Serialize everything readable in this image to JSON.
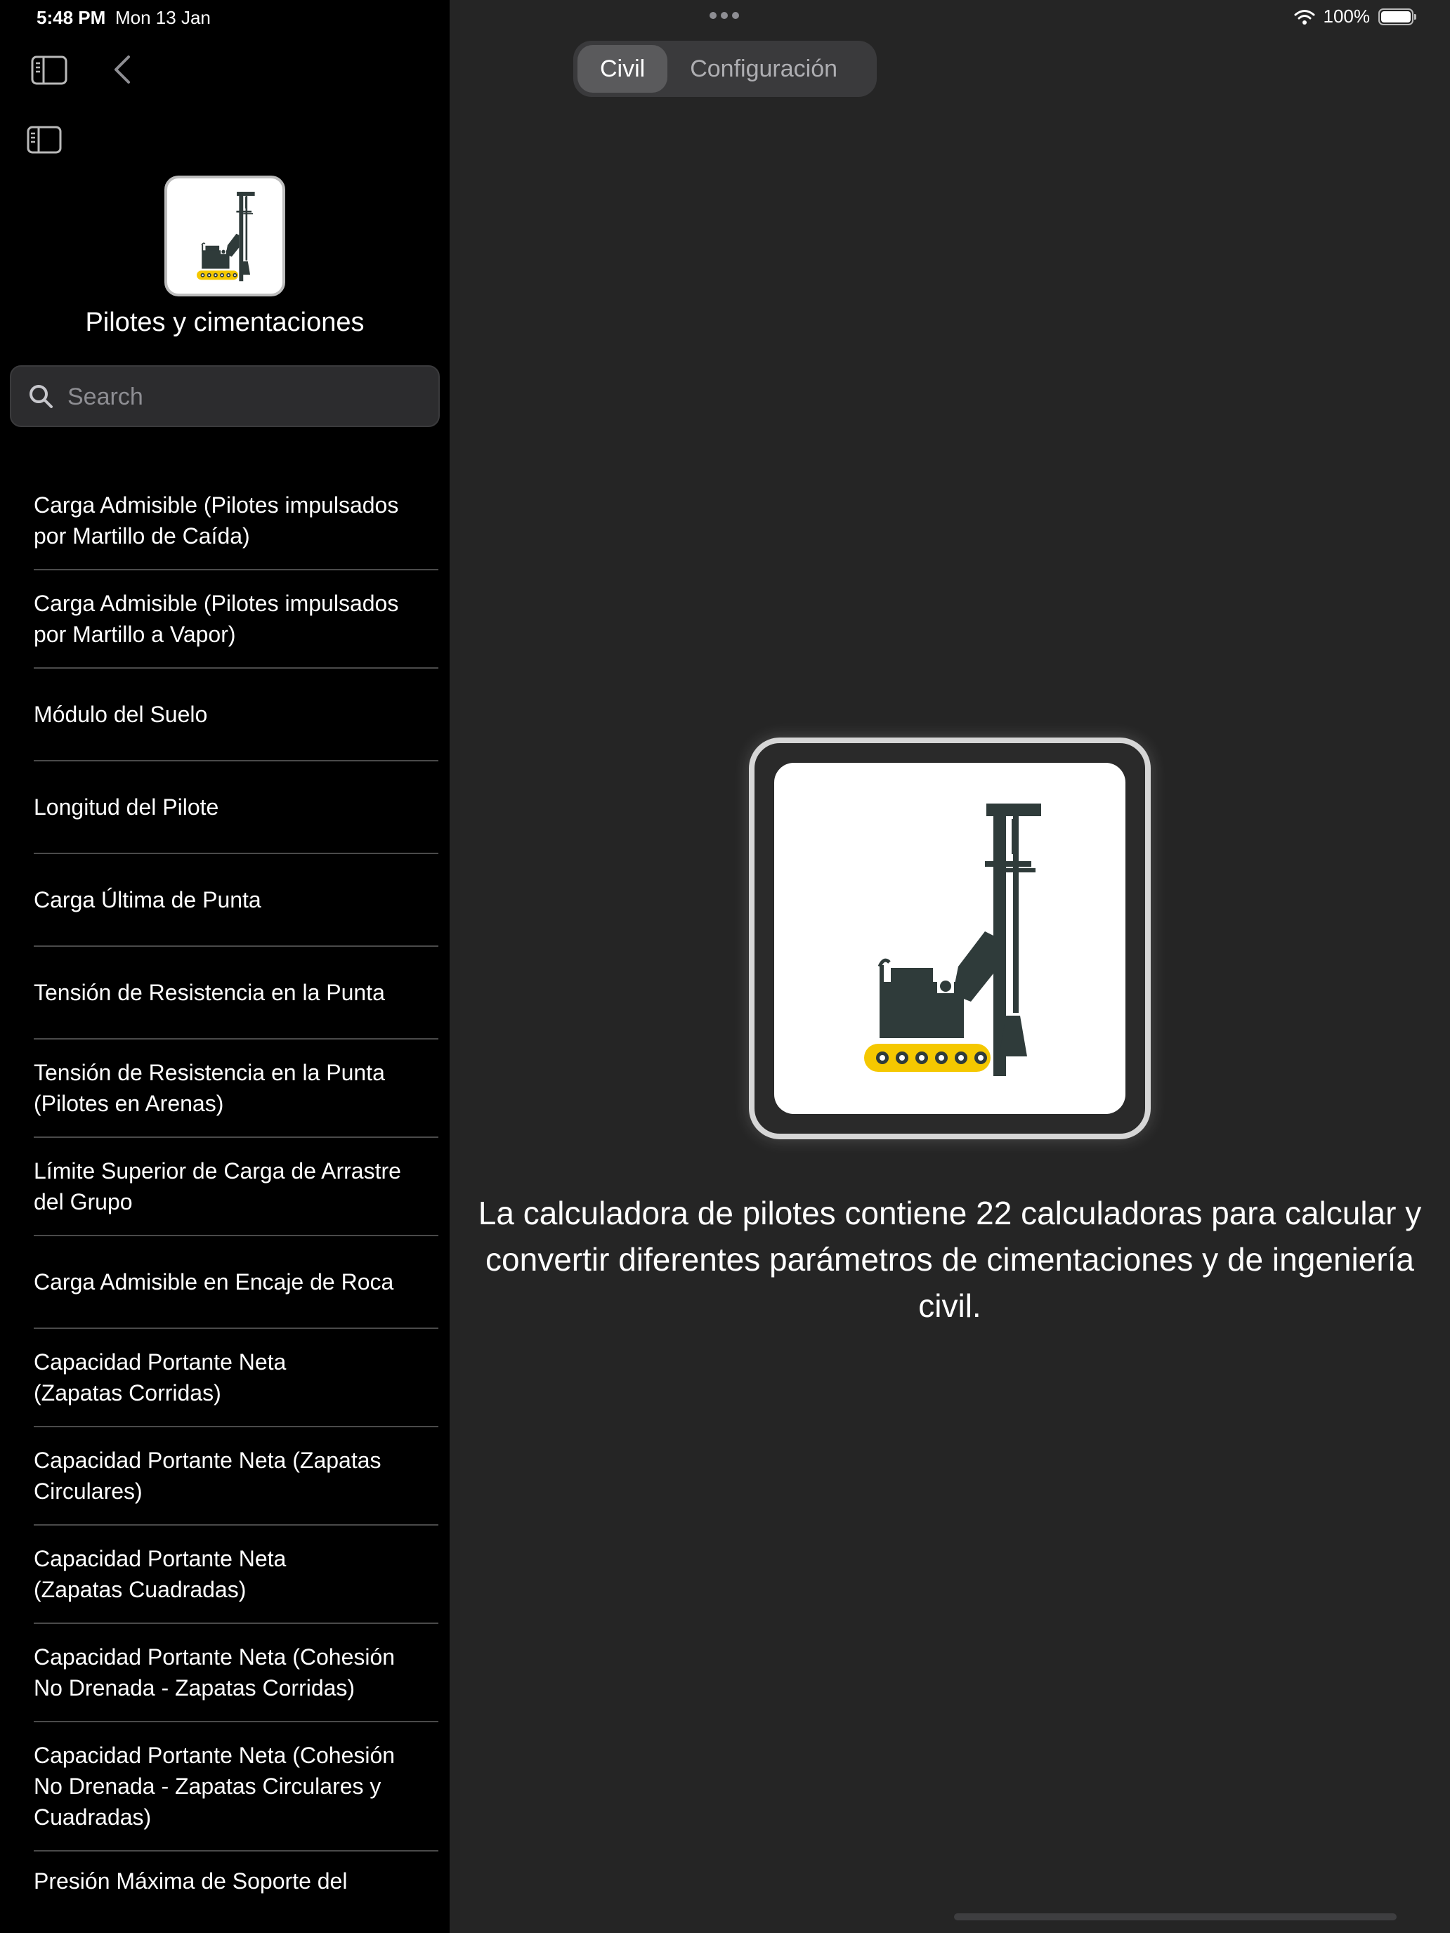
{
  "status_bar": {
    "time": "5:48 PM",
    "date": "Mon 13 Jan",
    "battery": "100%"
  },
  "sidebar": {
    "title": "Pilotes y cimentaciones",
    "search": {
      "placeholder": "Search",
      "value": ""
    },
    "items": [
      {
        "label": "Carga Admisible (Pilotes impulsados por Martillo de Caída)"
      },
      {
        "label": "Carga Admisible (Pilotes impulsados por Martillo a Vapor)"
      },
      {
        "label": "Módulo del Suelo"
      },
      {
        "label": "Longitud del Pilote"
      },
      {
        "label": "Carga Última de Punta"
      },
      {
        "label": "Tensión de Resistencia en la Punta"
      },
      {
        "label": "Tensión de Resistencia en la Punta (Pilotes en Arenas)"
      },
      {
        "label": "Límite Superior de Carga de Arrastre del Grupo"
      },
      {
        "label": "Carga Admisible en Encaje de Roca"
      },
      {
        "label": "Capacidad Portante Neta (Zapatas Corridas)"
      },
      {
        "label": "Capacidad Portante Neta (Zapatas Circulares)"
      },
      {
        "label": "Capacidad Portante Neta (Zapatas Cuadradas)"
      },
      {
        "label": "Capacidad Portante Neta (Cohesión No Drenada - Zapatas Corridas)"
      },
      {
        "label": "Capacidad Portante Neta (Cohesión No Drenada - Zapatas Circulares y Cuadradas)"
      },
      {
        "label": "Presión Máxima de Soporte del"
      }
    ]
  },
  "segmented_control": {
    "tabs": [
      {
        "label": "Civil",
        "selected": true
      },
      {
        "label": "Configuración",
        "selected": false
      }
    ]
  },
  "main": {
    "description": "La calculadora de pilotes contiene 22 calculadoras para calcular y convertir diferentes parámetros de cimentaciones y de ingeniería civil."
  },
  "icons": {
    "sidebar_toggle": "sidebar-icon",
    "back": "chevron-left-icon",
    "search": "magnifying-glass-icon",
    "wifi": "wifi-icon",
    "battery": "battery-icon",
    "more": "ellipsis-icon",
    "app": "pile-driver-icon"
  },
  "colors": {
    "sidebar_bg": "#000000",
    "main_bg": "#252525",
    "machine": "#2f3b3a",
    "track": "#f5c800",
    "divider": "#4a4a4a"
  }
}
